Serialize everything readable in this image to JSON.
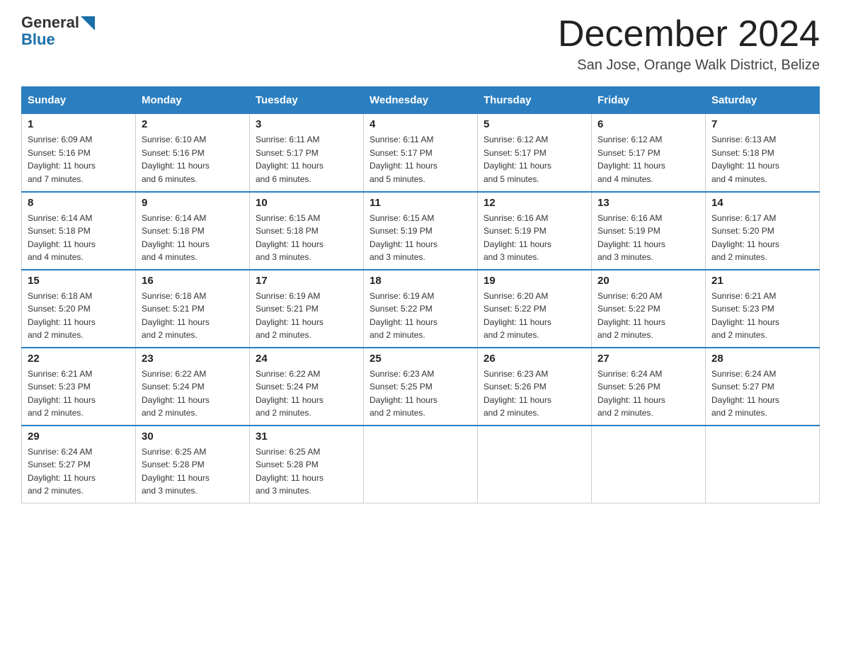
{
  "header": {
    "logo_general": "General",
    "logo_blue": "Blue",
    "month_title": "December 2024",
    "location": "San Jose, Orange Walk District, Belize"
  },
  "days_of_week": [
    "Sunday",
    "Monday",
    "Tuesday",
    "Wednesday",
    "Thursday",
    "Friday",
    "Saturday"
  ],
  "weeks": [
    [
      {
        "day": "1",
        "sunrise": "6:09 AM",
        "sunset": "5:16 PM",
        "daylight": "11 hours and 7 minutes."
      },
      {
        "day": "2",
        "sunrise": "6:10 AM",
        "sunset": "5:16 PM",
        "daylight": "11 hours and 6 minutes."
      },
      {
        "day": "3",
        "sunrise": "6:11 AM",
        "sunset": "5:17 PM",
        "daylight": "11 hours and 6 minutes."
      },
      {
        "day": "4",
        "sunrise": "6:11 AM",
        "sunset": "5:17 PM",
        "daylight": "11 hours and 5 minutes."
      },
      {
        "day": "5",
        "sunrise": "6:12 AM",
        "sunset": "5:17 PM",
        "daylight": "11 hours and 5 minutes."
      },
      {
        "day": "6",
        "sunrise": "6:12 AM",
        "sunset": "5:17 PM",
        "daylight": "11 hours and 4 minutes."
      },
      {
        "day": "7",
        "sunrise": "6:13 AM",
        "sunset": "5:18 PM",
        "daylight": "11 hours and 4 minutes."
      }
    ],
    [
      {
        "day": "8",
        "sunrise": "6:14 AM",
        "sunset": "5:18 PM",
        "daylight": "11 hours and 4 minutes."
      },
      {
        "day": "9",
        "sunrise": "6:14 AM",
        "sunset": "5:18 PM",
        "daylight": "11 hours and 4 minutes."
      },
      {
        "day": "10",
        "sunrise": "6:15 AM",
        "sunset": "5:18 PM",
        "daylight": "11 hours and 3 minutes."
      },
      {
        "day": "11",
        "sunrise": "6:15 AM",
        "sunset": "5:19 PM",
        "daylight": "11 hours and 3 minutes."
      },
      {
        "day": "12",
        "sunrise": "6:16 AM",
        "sunset": "5:19 PM",
        "daylight": "11 hours and 3 minutes."
      },
      {
        "day": "13",
        "sunrise": "6:16 AM",
        "sunset": "5:19 PM",
        "daylight": "11 hours and 3 minutes."
      },
      {
        "day": "14",
        "sunrise": "6:17 AM",
        "sunset": "5:20 PM",
        "daylight": "11 hours and 2 minutes."
      }
    ],
    [
      {
        "day": "15",
        "sunrise": "6:18 AM",
        "sunset": "5:20 PM",
        "daylight": "11 hours and 2 minutes."
      },
      {
        "day": "16",
        "sunrise": "6:18 AM",
        "sunset": "5:21 PM",
        "daylight": "11 hours and 2 minutes."
      },
      {
        "day": "17",
        "sunrise": "6:19 AM",
        "sunset": "5:21 PM",
        "daylight": "11 hours and 2 minutes."
      },
      {
        "day": "18",
        "sunrise": "6:19 AM",
        "sunset": "5:22 PM",
        "daylight": "11 hours and 2 minutes."
      },
      {
        "day": "19",
        "sunrise": "6:20 AM",
        "sunset": "5:22 PM",
        "daylight": "11 hours and 2 minutes."
      },
      {
        "day": "20",
        "sunrise": "6:20 AM",
        "sunset": "5:22 PM",
        "daylight": "11 hours and 2 minutes."
      },
      {
        "day": "21",
        "sunrise": "6:21 AM",
        "sunset": "5:23 PM",
        "daylight": "11 hours and 2 minutes."
      }
    ],
    [
      {
        "day": "22",
        "sunrise": "6:21 AM",
        "sunset": "5:23 PM",
        "daylight": "11 hours and 2 minutes."
      },
      {
        "day": "23",
        "sunrise": "6:22 AM",
        "sunset": "5:24 PM",
        "daylight": "11 hours and 2 minutes."
      },
      {
        "day": "24",
        "sunrise": "6:22 AM",
        "sunset": "5:24 PM",
        "daylight": "11 hours and 2 minutes."
      },
      {
        "day": "25",
        "sunrise": "6:23 AM",
        "sunset": "5:25 PM",
        "daylight": "11 hours and 2 minutes."
      },
      {
        "day": "26",
        "sunrise": "6:23 AM",
        "sunset": "5:26 PM",
        "daylight": "11 hours and 2 minutes."
      },
      {
        "day": "27",
        "sunrise": "6:24 AM",
        "sunset": "5:26 PM",
        "daylight": "11 hours and 2 minutes."
      },
      {
        "day": "28",
        "sunrise": "6:24 AM",
        "sunset": "5:27 PM",
        "daylight": "11 hours and 2 minutes."
      }
    ],
    [
      {
        "day": "29",
        "sunrise": "6:24 AM",
        "sunset": "5:27 PM",
        "daylight": "11 hours and 2 minutes."
      },
      {
        "day": "30",
        "sunrise": "6:25 AM",
        "sunset": "5:28 PM",
        "daylight": "11 hours and 3 minutes."
      },
      {
        "day": "31",
        "sunrise": "6:25 AM",
        "sunset": "5:28 PM",
        "daylight": "11 hours and 3 minutes."
      },
      null,
      null,
      null,
      null
    ]
  ],
  "labels": {
    "sunrise": "Sunrise:",
    "sunset": "Sunset:",
    "daylight": "Daylight:"
  }
}
